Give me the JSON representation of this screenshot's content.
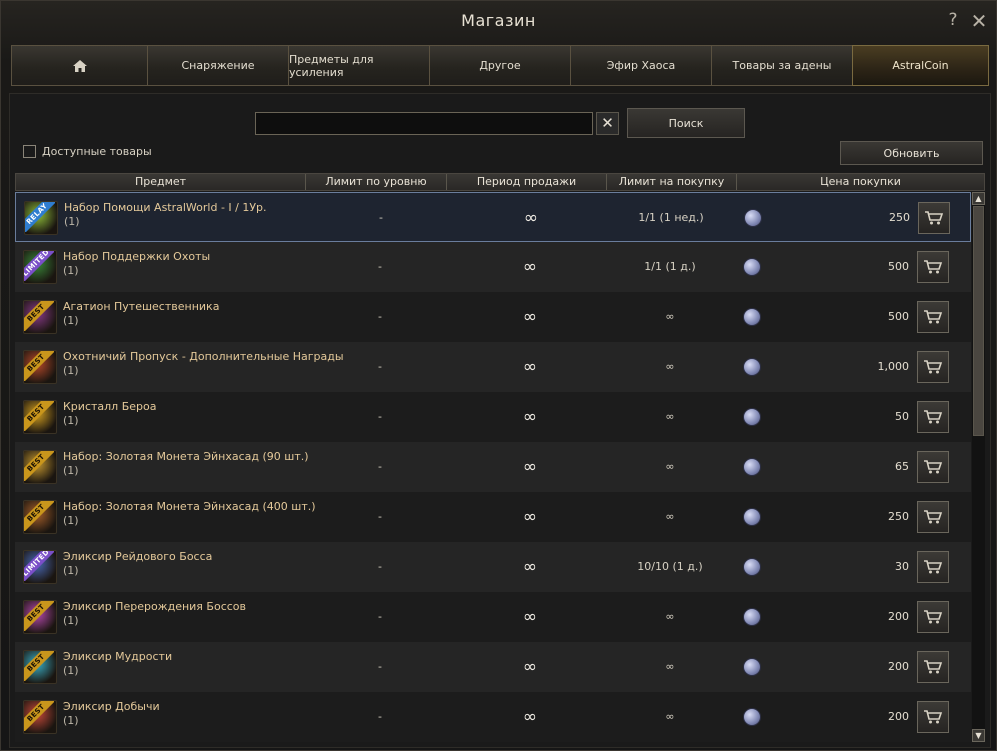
{
  "window": {
    "title": "Магазин",
    "help": "?",
    "close": "✕"
  },
  "tabs": [
    {
      "label": "",
      "icon": "home-icon"
    },
    {
      "label": "Снаряжение"
    },
    {
      "label": "Предметы для усиления"
    },
    {
      "label": "Другое"
    },
    {
      "label": "Эфир Хаоса"
    },
    {
      "label": "Товары за адены"
    },
    {
      "label": "AstralCoin",
      "active": true
    }
  ],
  "search": {
    "value": "",
    "clear": "✕",
    "button": "Поиск"
  },
  "filter": {
    "available_label": "Доступные товары",
    "checked": false
  },
  "refresh_label": "Обновить",
  "columns": [
    "Предмет",
    "Лимит по уровню",
    "Период продажи",
    "Лимит на покупку",
    "Цена покупки"
  ],
  "items": [
    {
      "name": "Набор Помощи AstralWorld - I / 1Ур.",
      "qty": "(1)",
      "badge": "RELAY",
      "level": "-",
      "period": "∞",
      "limit": "1/1 (1 нед.)",
      "price": "250",
      "color": "#8fbf3a"
    },
    {
      "name": "Набор Поддержки Охоты",
      "qty": "(1)",
      "badge": "LIMITED",
      "level": "-",
      "period": "∞",
      "limit": "1/1 (1 д.)",
      "price": "500",
      "color": "#3a8a3a"
    },
    {
      "name": "Агатион Путешественника",
      "qty": "(1)",
      "badge": "BEST",
      "level": "-",
      "period": "∞",
      "limit": "∞",
      "price": "500",
      "color": "#8a3a8a"
    },
    {
      "name": "Охотничий Пропуск - Дополнительные Награды",
      "qty": "(1)",
      "badge": "BEST",
      "level": "-",
      "period": "∞",
      "limit": "∞",
      "price": "1,000",
      "color": "#b84a2a"
    },
    {
      "name": "Кристалл Бероа",
      "qty": "(1)",
      "badge": "BEST",
      "level": "-",
      "period": "∞",
      "limit": "∞",
      "price": "50",
      "color": "#d4a020"
    },
    {
      "name": "Набор: Золотая Монета Эйнхасад (90 шт.)",
      "qty": "(1)",
      "badge": "BEST",
      "level": "-",
      "period": "∞",
      "limit": "∞",
      "price": "65",
      "color": "#c89a30"
    },
    {
      "name": "Набор: Золотая Монета Эйнхасад (400 шт.)",
      "qty": "(1)",
      "badge": "BEST",
      "level": "-",
      "period": "∞",
      "limit": "∞",
      "price": "250",
      "color": "#a8602a"
    },
    {
      "name": "Эликсир Рейдового Босса",
      "qty": "(1)",
      "badge": "LIMITED",
      "level": "-",
      "period": "∞",
      "limit": "10/10 (1 д.)",
      "price": "30",
      "color": "#4a6ab8"
    },
    {
      "name": "Эликсир Перерождения Боссов",
      "qty": "(1)",
      "badge": "BEST",
      "level": "-",
      "period": "∞",
      "limit": "∞",
      "price": "200",
      "color": "#b84ab0"
    },
    {
      "name": "Эликсир Мудрости",
      "qty": "(1)",
      "badge": "BEST",
      "level": "-",
      "period": "∞",
      "limit": "∞",
      "price": "200",
      "color": "#3ab0c8"
    },
    {
      "name": "Эликсир Добычи",
      "qty": "(1)",
      "badge": "BEST",
      "level": "-",
      "period": "∞",
      "limit": "∞",
      "price": "200",
      "color": "#c84a3a"
    }
  ],
  "scroll": {
    "up": "▲",
    "down": "▼"
  }
}
